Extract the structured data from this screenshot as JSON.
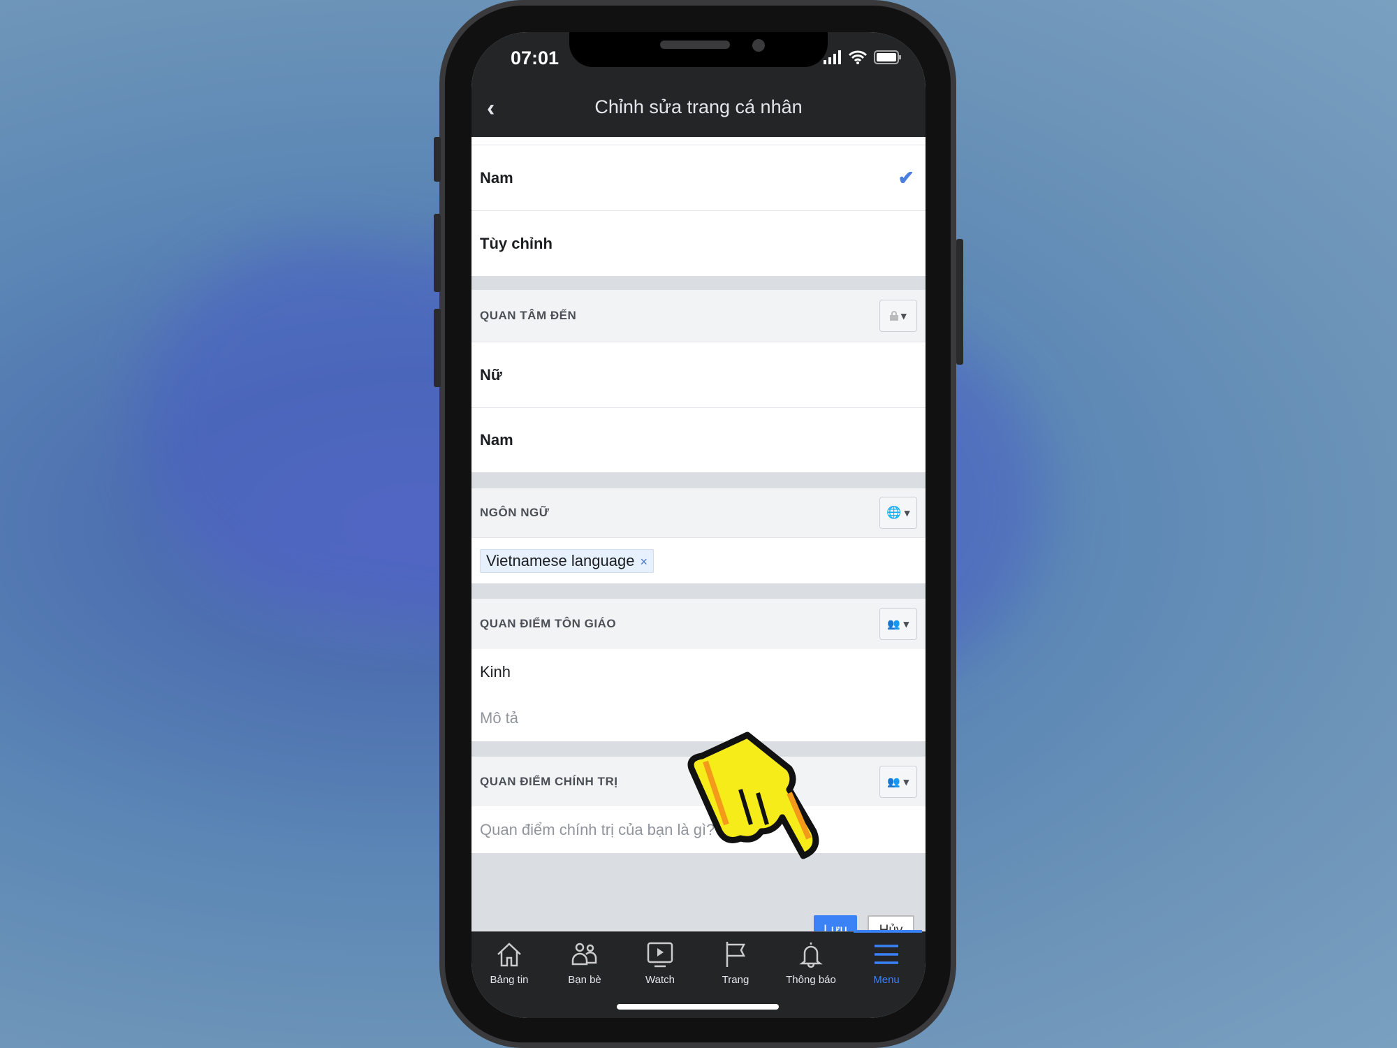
{
  "status_bar": {
    "time": "07:01"
  },
  "header": {
    "title": "Chỉnh sửa trang cá nhân"
  },
  "gender_options": [
    {
      "label": "Nam",
      "selected": true
    },
    {
      "label": "Tùy chỉnh",
      "selected": false
    }
  ],
  "interested_in": {
    "heading": "QUAN TÂM ĐẾN",
    "privacy_icon": "lock-icon",
    "items": [
      "Nữ",
      "Nam"
    ]
  },
  "languages": {
    "heading": "NGÔN NGỮ",
    "privacy_icon": "globe-icon",
    "tags": [
      "Vietnamese language"
    ],
    "remove_symbol": "×"
  },
  "religion": {
    "heading": "QUAN ĐIỂM TÔN GIÁO",
    "privacy_icon": "friends-icon",
    "value": "Kinh",
    "description_placeholder": "Mô tả"
  },
  "politics": {
    "heading": "QUAN ĐIỂM CHÍNH TRỊ",
    "privacy_icon": "friends-icon",
    "placeholder": "Quan điểm chính trị của bạn là gì?"
  },
  "actions": {
    "save": "Lưu",
    "cancel": "Hủy"
  },
  "tabs": [
    {
      "label": "Bảng tin",
      "icon": "home-icon"
    },
    {
      "label": "Bạn bè",
      "icon": "friends-icon"
    },
    {
      "label": "Watch",
      "icon": "watch-icon"
    },
    {
      "label": "Trang",
      "icon": "flag-icon"
    },
    {
      "label": "Thông báo",
      "icon": "bell-icon"
    },
    {
      "label": "Menu",
      "icon": "menu-icon",
      "active": true
    }
  ],
  "colors": {
    "accent": "#3b82f6",
    "topbar": "#242526",
    "hand": "#f5ec1a"
  }
}
